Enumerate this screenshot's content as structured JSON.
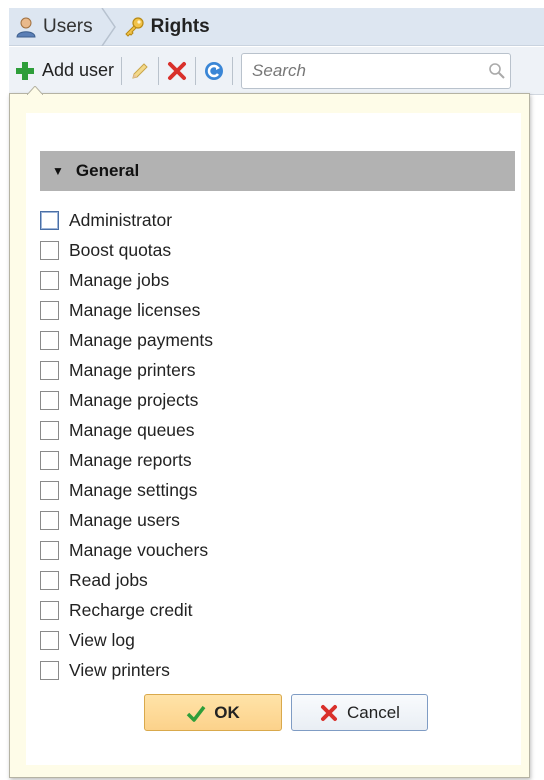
{
  "breadcrumb": {
    "users_label": "Users",
    "rights_label": "Rights"
  },
  "toolbar": {
    "add_user_label": "Add user",
    "search_placeholder": "Search"
  },
  "rights_panel": {
    "section_title": "General",
    "items": [
      {
        "label": "Administrator",
        "checked": false
      },
      {
        "label": "Boost quotas",
        "checked": false
      },
      {
        "label": "Manage jobs",
        "checked": false
      },
      {
        "label": "Manage licenses",
        "checked": false
      },
      {
        "label": "Manage payments",
        "checked": false
      },
      {
        "label": "Manage printers",
        "checked": false
      },
      {
        "label": "Manage projects",
        "checked": false
      },
      {
        "label": "Manage queues",
        "checked": false
      },
      {
        "label": "Manage reports",
        "checked": false
      },
      {
        "label": "Manage settings",
        "checked": false
      },
      {
        "label": "Manage users",
        "checked": false
      },
      {
        "label": "Manage vouchers",
        "checked": false
      },
      {
        "label": "Read jobs",
        "checked": false
      },
      {
        "label": "Recharge credit",
        "checked": false
      },
      {
        "label": "View log",
        "checked": false
      },
      {
        "label": "View printers",
        "checked": false
      }
    ],
    "ok_label": "OK",
    "cancel_label": "Cancel"
  },
  "icons": {
    "user": "user-icon",
    "key": "key-icon",
    "add": "plus-icon",
    "edit": "pencil-icon",
    "delete": "delete-x-icon",
    "refresh": "refresh-icon",
    "search": "magnifier-icon",
    "ok": "checkmark-icon",
    "cancel": "cancel-x-icon"
  },
  "colors": {
    "panel_bg": "#fefce8",
    "ok_button": "#fcd28b",
    "section_header": "#b2b2b2",
    "add_green": "#2e9e3a",
    "delete_red": "#d9302b"
  }
}
